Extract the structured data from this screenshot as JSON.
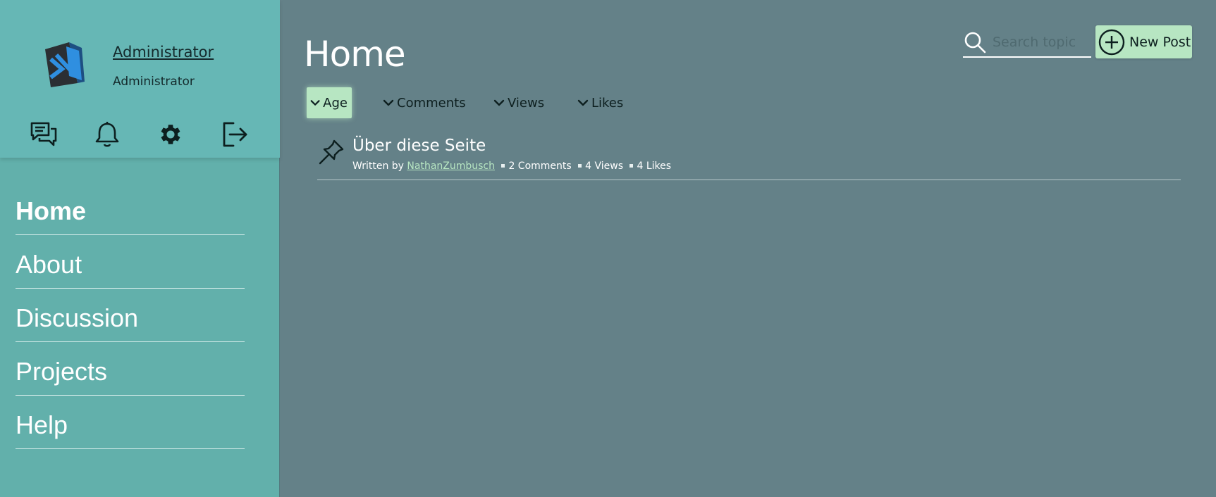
{
  "user": {
    "name": "Administrator",
    "role": "Administrator"
  },
  "header_icons": [
    "chat-icon",
    "bell-icon",
    "gear-icon",
    "logout-icon"
  ],
  "nav": {
    "items": [
      {
        "label": "Home",
        "active": true
      },
      {
        "label": "About",
        "active": false
      },
      {
        "label": "Discussion",
        "active": false
      },
      {
        "label": "Projects",
        "active": false
      },
      {
        "label": "Help",
        "active": false
      }
    ]
  },
  "main": {
    "title": "Home",
    "search_placeholder": "Search topic",
    "new_post_label": "New Post",
    "filters": [
      {
        "label": "Age",
        "active": true
      },
      {
        "label": "Comments",
        "active": false
      },
      {
        "label": "Views",
        "active": false
      },
      {
        "label": "Likes",
        "active": false
      }
    ],
    "posts": [
      {
        "title": "Über diese Seite",
        "pinned": true,
        "written_by": "Written by",
        "author": "NathanZumbusch",
        "comments": "2 Comments",
        "views": "4 Views",
        "likes": "4 Likes"
      }
    ]
  },
  "colors": {
    "sidebar": "#62b0ab",
    "main_bg": "#648188",
    "accent": "#b7e6c2"
  }
}
